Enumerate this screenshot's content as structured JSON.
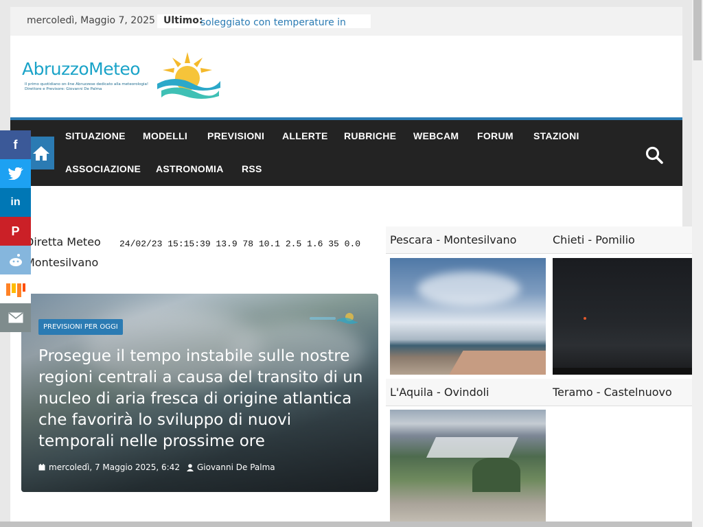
{
  "topbar": {
    "date": "mercoledì, Maggio 7, 2025",
    "ticker_label": "Ultimo:",
    "ticker_text": "soleggiato con temperature in"
  },
  "logo": {
    "brand": "AbruzzoMeteo",
    "tagline": "Il primo quotidiano on-line Abruzzese dedicato alla meteorologia! Direttore e Previsore: Giovanni De Palma"
  },
  "nav": {
    "items": [
      "SITUAZIONE",
      "MODELLI",
      "PREVISIONI",
      "ALLERTE",
      "RUBRICHE",
      "WEBCAM",
      "FORUM",
      "STAZIONI",
      "ASSOCIAZIONE",
      "ASTRONOMIA",
      "RSS"
    ]
  },
  "widget": {
    "title_line1": "Diretta Meteo",
    "title_line2": "Montesilvano",
    "data_line": "24/02/23 15:15:39 13.9 78 10.1 2.5 1.6 35 0.0"
  },
  "featured": {
    "category": "PREVISIONI PER OGGI",
    "title": "Prosegue il tempo instabile sulle nostre regioni centrali a causa del transito di un nucleo di aria fresca di origine atlantica che favorirà lo sviluppo di nuovi temporali nelle prossime ore",
    "date": "mercoledì, 7 Maggio 2025, 6:42",
    "author": "Giovanni De Palma"
  },
  "webcams": [
    {
      "name": "Pescara - Montesilvano"
    },
    {
      "name": "Chieti - Pomilio"
    },
    {
      "name": "L'Aquila - Ovindoli"
    },
    {
      "name": "Teramo - Castelnuovo"
    }
  ],
  "social": [
    {
      "icon": "facebook-icon",
      "glyph": "f",
      "color": "#3b5998"
    },
    {
      "icon": "twitter-icon",
      "glyph": "t",
      "color": "#1da1f2"
    },
    {
      "icon": "linkedin-icon",
      "glyph": "in",
      "color": "#0077b5"
    },
    {
      "icon": "pinterest-icon",
      "glyph": "P",
      "color": "#cb2027"
    },
    {
      "icon": "reddit-icon",
      "glyph": "r",
      "color": "#85b6dd"
    },
    {
      "icon": "mix-icon",
      "glyph": "m",
      "color": "#ffffff"
    },
    {
      "icon": "email-icon",
      "glyph": "✉",
      "color": "#7f8c8d"
    }
  ],
  "colors": {
    "accent": "#2b7bb3",
    "nav_bg": "#232323"
  }
}
